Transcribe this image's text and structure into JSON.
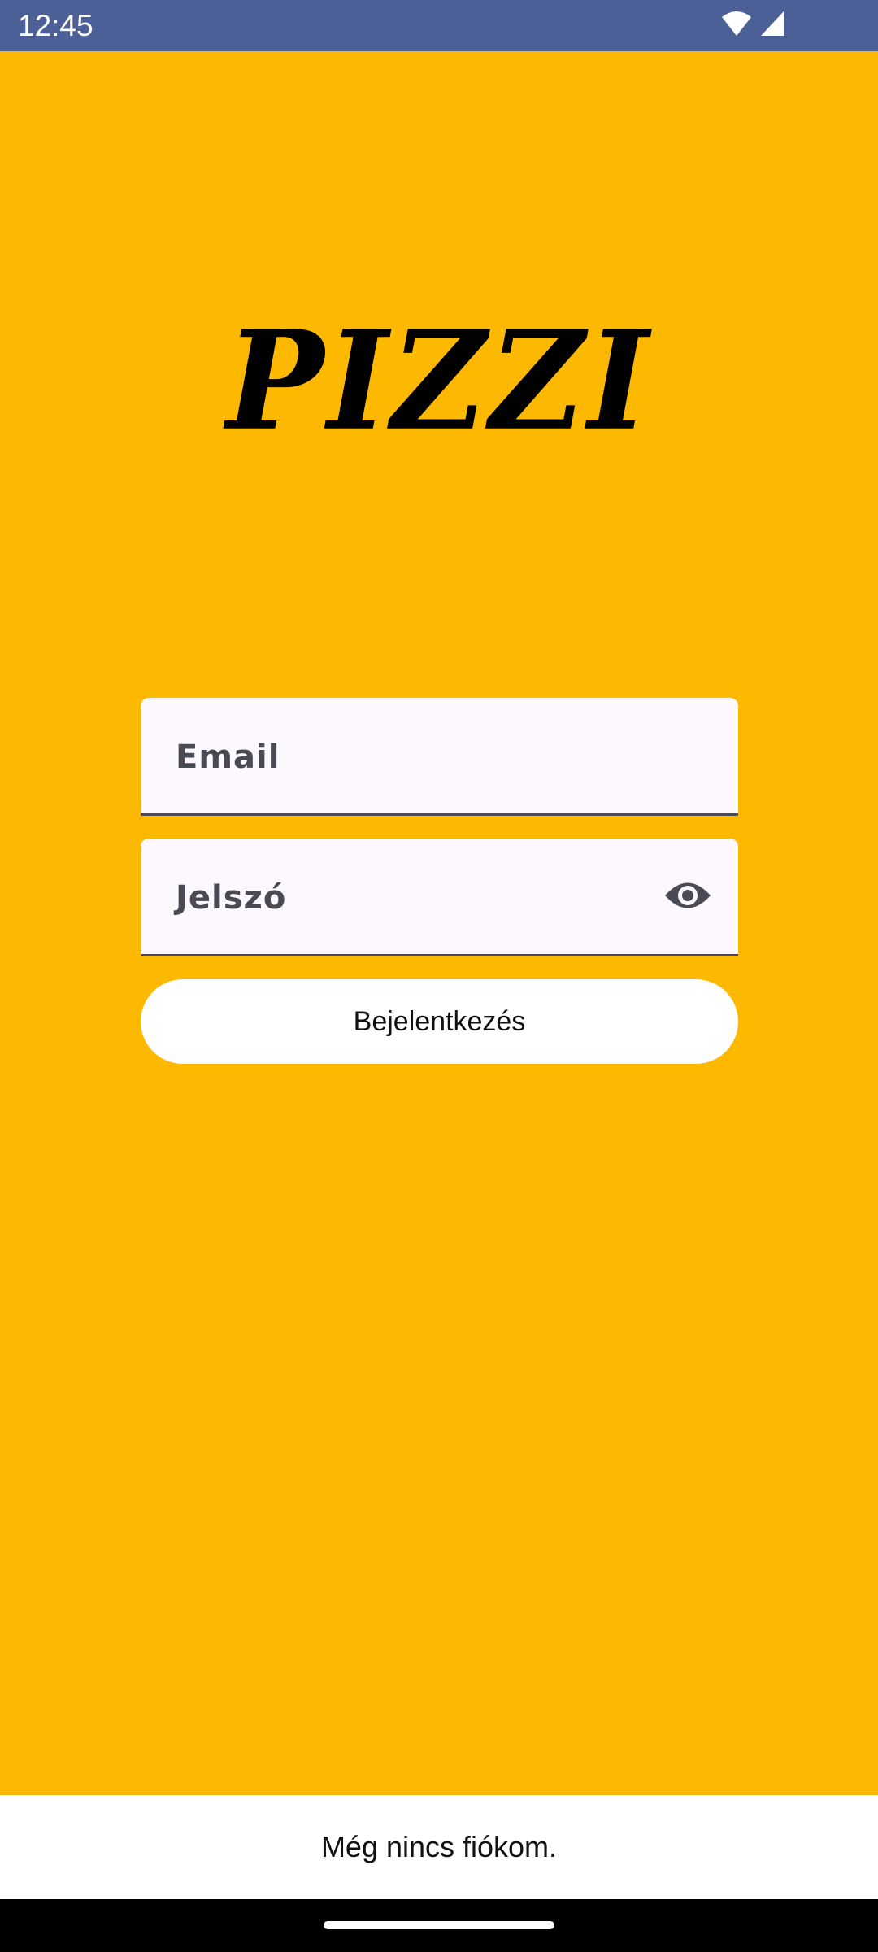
{
  "status_bar": {
    "time": "12:45",
    "icons": [
      "wifi-icon",
      "cellular-signal-icon"
    ]
  },
  "app": {
    "logo_text": "PIZZI"
  },
  "form": {
    "email_placeholder": "Email",
    "password_placeholder": "Jelszó",
    "login_button_label": "Bejelentkezés"
  },
  "footer": {
    "register_label": "Még nincs fiókom."
  },
  "colors": {
    "background": "#FDB802",
    "status_bar": "#4D5F97",
    "field_background": "#FCF8FD",
    "field_text": "#4A4A55"
  }
}
